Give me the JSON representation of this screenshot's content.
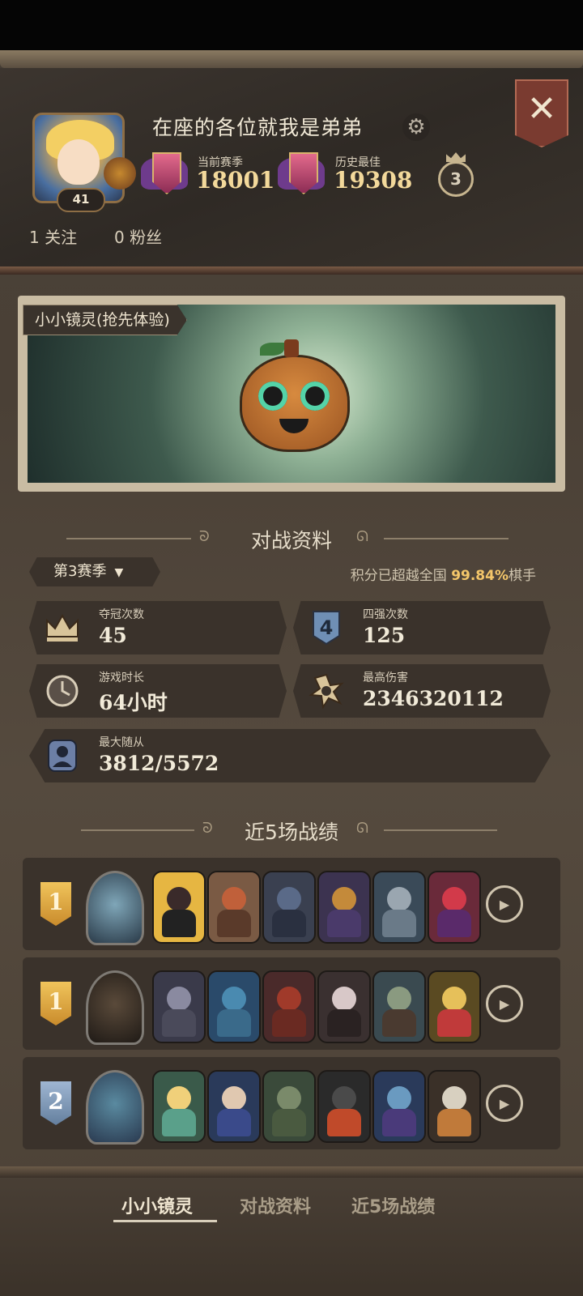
{
  "profile": {
    "username": "在座的各位就我是弟弟",
    "level": "41",
    "current_season_label": "当前赛季",
    "current_season_value": "18001",
    "best_label": "历史最佳",
    "best_value": "19308",
    "crown_count": "3",
    "follow": "1 关注",
    "fans": "0 粉丝"
  },
  "pet": {
    "name": "小小镜灵(抢先体验)"
  },
  "battle": {
    "title": "对战资料",
    "season_select": "第3赛季",
    "rank_prefix": "积分已超越全国 ",
    "rank_pct": "99.84%",
    "rank_suffix": "棋手",
    "stats": [
      {
        "label": "夺冠次数",
        "value": "45",
        "icon": "crown-icon"
      },
      {
        "label": "四强次数",
        "value": "125",
        "icon": "top4-icon"
      },
      {
        "label": "游戏时长",
        "value": "64小时",
        "icon": "clock-icon"
      },
      {
        "label": "最高伤害",
        "value": "2346320112",
        "icon": "damage-icon"
      },
      {
        "label": "最大随从",
        "value": "3812/5572",
        "icon": "minion-icon"
      }
    ]
  },
  "recent": {
    "title": "近5场战绩",
    "matches": [
      {
        "place": "1",
        "tier": "gold"
      },
      {
        "place": "1",
        "tier": "gold"
      },
      {
        "place": "2",
        "tier": "blue"
      }
    ]
  },
  "tabs": [
    "小小镜灵",
    "对战资料",
    "近5场战绩"
  ],
  "colors": {
    "accent_gold": "#f3d99b",
    "rank_pct": "#f3c66a",
    "background": "#4a4036"
  }
}
